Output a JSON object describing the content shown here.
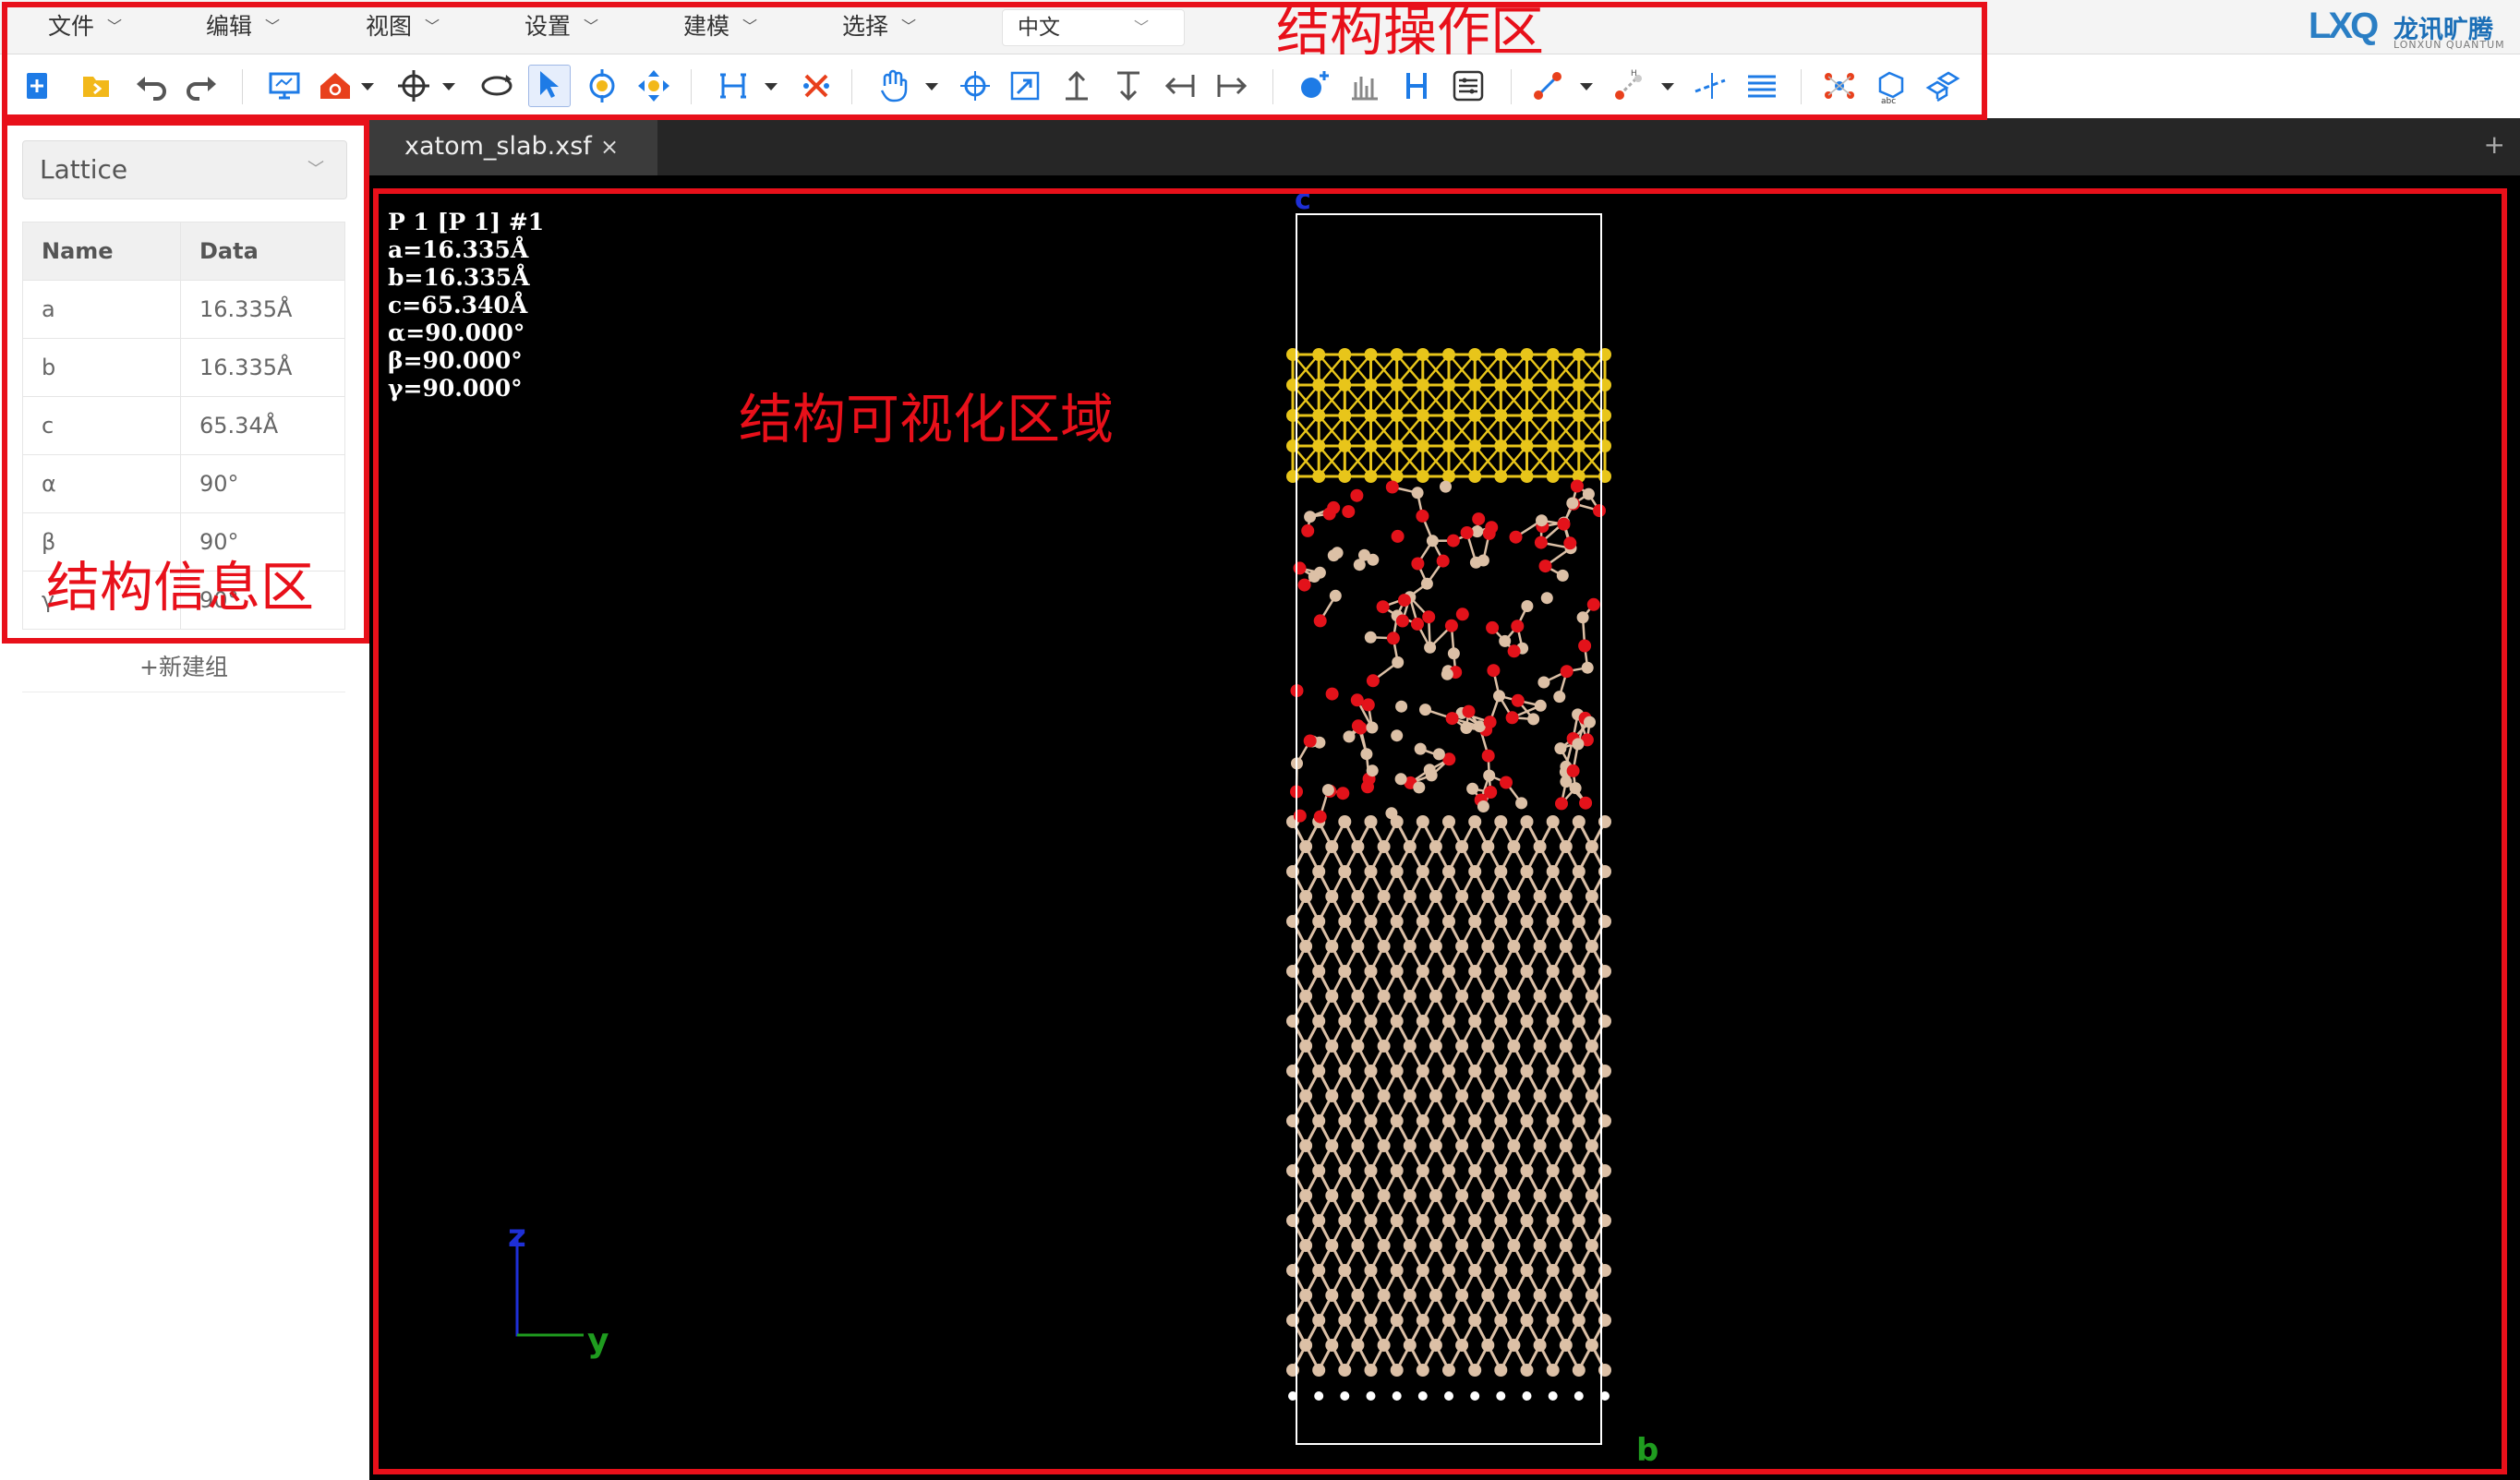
{
  "menu": {
    "items": [
      {
        "label": "文件"
      },
      {
        "label": "编辑"
      },
      {
        "label": "视图"
      },
      {
        "label": "设置"
      },
      {
        "label": "建模"
      },
      {
        "label": "选择"
      }
    ],
    "language": "中文"
  },
  "logo": {
    "mark": "LXQ",
    "name": "龙讯旷腾",
    "sub": "LONXUN QUANTUM"
  },
  "toolbar": {
    "icons": [
      "new-file-icon",
      "open-folder-icon",
      "undo-icon",
      "redo-icon",
      "monitor-icon",
      "home-view-icon",
      "target-icon",
      "rotate-view-icon",
      "select-pointer-icon",
      "rotate-tool-icon",
      "move-tool-icon",
      "measure-icon",
      "delete-bond-icon",
      "hand-pan-icon",
      "move-atom-icon",
      "scale-icon",
      "up-arrow-icon",
      "down-arrow-icon",
      "left-arrow-icon",
      "right-arrow-icon",
      "add-atom-icon",
      "chart-icon",
      "hydrogen-icon",
      "properties-icon",
      "bond-icon",
      "hydrogen-bond-icon",
      "slice-icon",
      "layers-icon",
      "molecule-icon",
      "cell-label-icon",
      "supercell-icon"
    ]
  },
  "left_panel": {
    "selector": "Lattice",
    "table": {
      "headers": [
        "Name",
        "Data"
      ],
      "rows": [
        {
          "name": "a",
          "data": "16.335Å"
        },
        {
          "name": "b",
          "data": "16.335Å"
        },
        {
          "name": "c",
          "data": "65.34Å"
        },
        {
          "name": "α",
          "data": "90°"
        },
        {
          "name": "β",
          "data": "90°"
        },
        {
          "name": "γ",
          "data": "90°"
        }
      ]
    },
    "new_group": "+新建组"
  },
  "tabs": [
    {
      "label": "xatom_slab.xsf",
      "close": "×"
    }
  ],
  "tab_add": "+",
  "viewport": {
    "cell_info": "P 1 [P 1] #1\na=16.335Å\nb=16.335Å\nc=65.340Å\nα=90.000°\nβ=90.000°\nγ=90.000°",
    "axis_labels": {
      "c": "c",
      "b": "b",
      "z": "z",
      "y": "y"
    },
    "colors": {
      "gold": "#e8c51a",
      "silicon": "#dcc0a6",
      "oxygen": "#e3121a",
      "hydrogen": "#ffffff",
      "cell_edge": "#ffffff",
      "axis_z": "#1e2fd6",
      "axis_y": "#1f9c1f"
    }
  },
  "annotations": {
    "toolbar_label": "结构操作区",
    "viewport_label": "结构可视化区域",
    "info_label": "结构信息区",
    "color": "#e8101a"
  }
}
